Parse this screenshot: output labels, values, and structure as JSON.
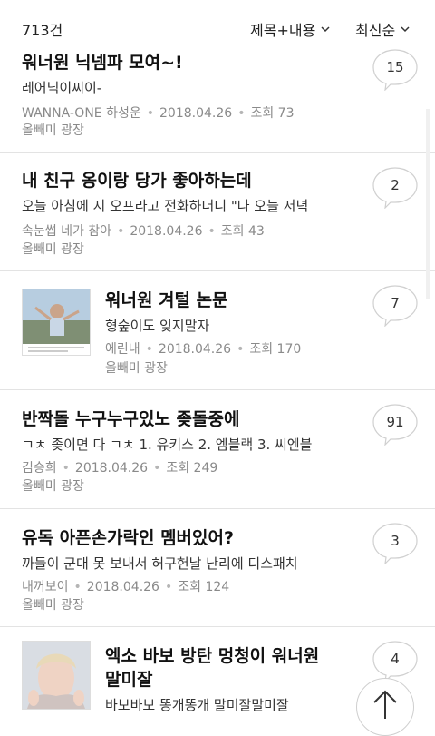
{
  "header": {
    "count": "713건",
    "search_scope": "제목+내용",
    "sort": "최신순"
  },
  "posts": [
    {
      "title": "워너원 닉넴파 모여~!",
      "preview": "레어닉이찌이-",
      "author": "WANNA-ONE 하성운",
      "date": "2018.04.26",
      "views": "조회 73",
      "cafe": "올빼미 광장",
      "comments": "15"
    },
    {
      "title": "내 친구 옹이랑 당가 좋아하는데",
      "preview": "오늘 아침에 지 오프라고 전화하더니 \"나 오늘 저녁",
      "author": "속눈썹 네가 참아",
      "date": "2018.04.26",
      "views": "조회 43",
      "cafe": "올빼미 광장",
      "comments": "2"
    },
    {
      "title": "워너원 겨털 논문",
      "preview": "형숲이도 잊지말자",
      "author": "에린내",
      "date": "2018.04.26",
      "views": "조회 170",
      "cafe": "올빼미 광장",
      "comments": "7"
    },
    {
      "title": "반짝돌 누구누구있노 좆돌중에",
      "preview": "ㄱㅊ 좆이면 다 ㄱㅊ 1. 유키스 2. 엠블랙 3. 씨엔블",
      "author": "김승희",
      "date": "2018.04.26",
      "views": "조회 249",
      "cafe": "올빼미 광장",
      "comments": "91"
    },
    {
      "title": "유독 아픈손가락인 멤버있어?",
      "preview": "까들이 군대 못 보내서 허구헌날 난리에 디스패치",
      "author": "내꺼보이",
      "date": "2018.04.26",
      "views": "조회 124",
      "cafe": "올빼미 광장",
      "comments": "3"
    },
    {
      "title_line1": "엑소 바보 방탄 멍청이 워너원",
      "title_line2": "말미잘",
      "preview": "바보바보 똥개똥개 말미잘말미잘",
      "comments": "4"
    }
  ],
  "colors": {
    "meta": "#8a8a8a",
    "divider": "#e3e3e3"
  },
  "icons": {
    "filter": "chevron-down-icon",
    "scroll_top": "arrow-up-icon",
    "comments": "speech-bubble-icon"
  }
}
